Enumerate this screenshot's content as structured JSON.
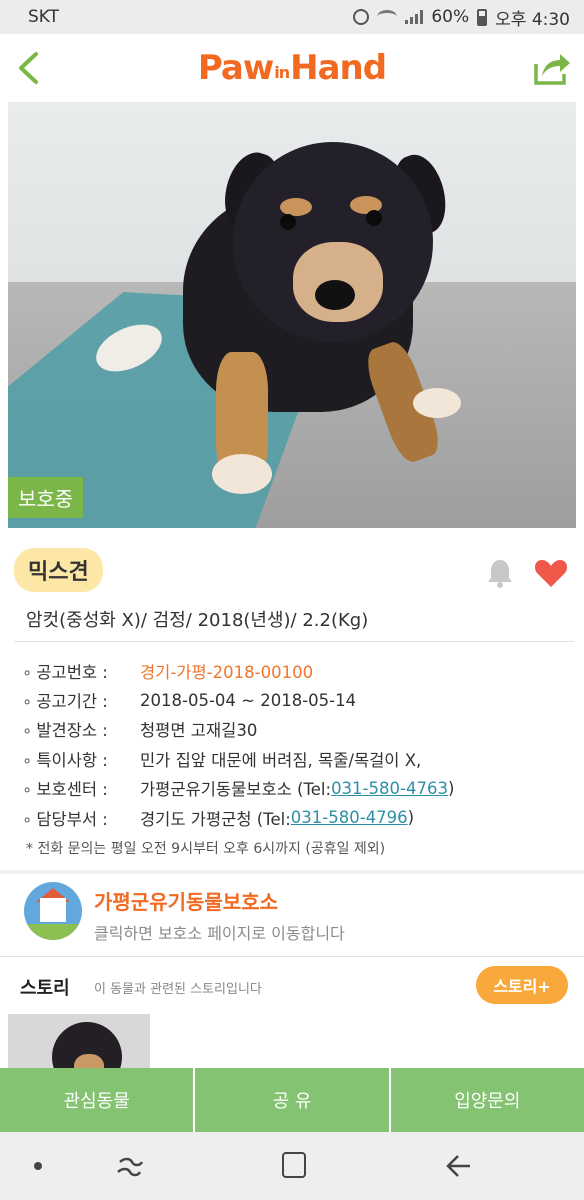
{
  "status_bar": {
    "carrier": "SKT",
    "battery": "60%",
    "time": "오후 4:30"
  },
  "header": {
    "logo_part1": "Paw",
    "logo_part2": "in",
    "logo_part3": "Hand",
    "accent_color": "#f26a21"
  },
  "photo": {
    "status_tag": "보호중",
    "tag_color": "#7ab648"
  },
  "animal": {
    "breed": "믹스견",
    "summary": "암컷(중성화 X)/ 검정/ 2018(년생)/ 2.2(Kg)",
    "favorited": true
  },
  "details": [
    {
      "label": "공고번호 :",
      "value": "경기-가평-2018-00100"
    },
    {
      "label": "공고기간 :",
      "value": "2018-05-04 ~ 2018-05-14"
    },
    {
      "label": "발견장소 :",
      "value": "청평면 고재길30"
    },
    {
      "label": "특이사항 :",
      "value": "민가 집앞 대문에 버려짐, 목줄/목걸이 X,"
    },
    {
      "label": "보호센터 :",
      "value": "가평군유기동물보호소 (Tel: ",
      "phone": "031-580-4763",
      "suffix": ")"
    },
    {
      "label": "담당부서 :",
      "value": "경기도 가평군청 (Tel: ",
      "phone": "031-580-4796",
      "suffix": ")"
    }
  ],
  "note": "* 전화 문의는 평일 오전 9시부터 오후 6시까지 (공휴일 제외)",
  "shelter_card": {
    "name": "가평군유기동물보호소",
    "subtitle": "클릭하면 보호소 페이지로 이동합니다"
  },
  "story": {
    "title": "스토리",
    "subtitle": "이 동물과 관련된 스토리입니다",
    "button": "스토리+"
  },
  "actions": {
    "favorite": "관심동물",
    "share": "공 유",
    "inquiry": "입양문의"
  }
}
